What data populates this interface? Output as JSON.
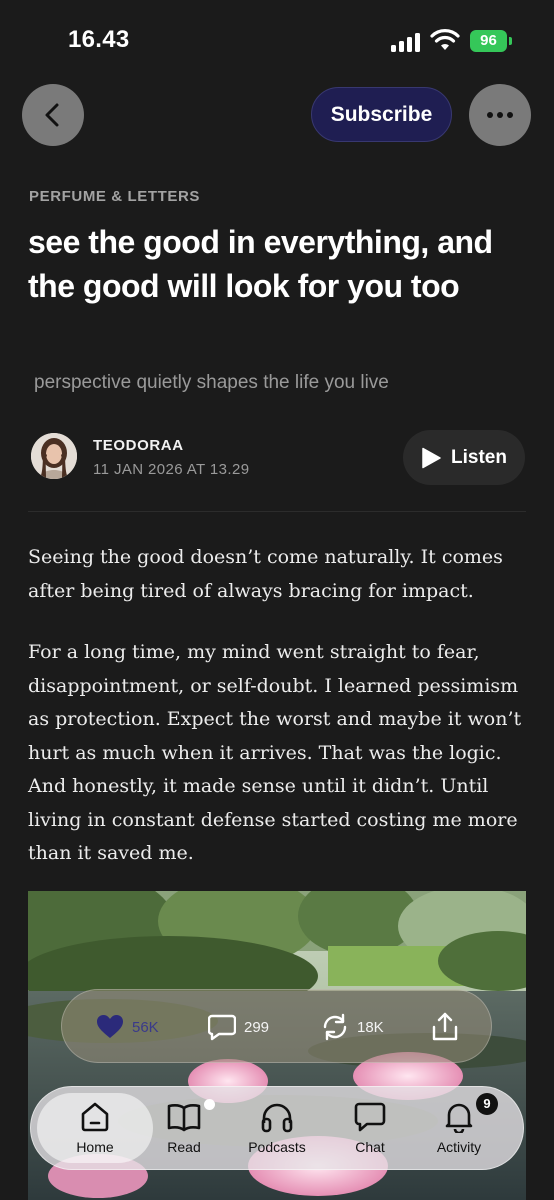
{
  "status_bar": {
    "time": "16.43",
    "battery": "96"
  },
  "nav": {
    "subscribe_label": "Subscribe",
    "back_icon": "chevron-left-icon",
    "more_icon": "ellipsis-icon"
  },
  "article": {
    "publication": "PERFUME & LETTERS",
    "title": "see the good in everything, and the good will look for you too",
    "subtitle": "perspective quietly shapes the life you live",
    "author": "TEODORAA",
    "date": "11 JAN 2026 AT 13.29",
    "listen_label": "Listen",
    "paragraphs": [
      " Seeing the good doesn’t come naturally. It comes after being tired of always bracing for impact.",
      " For a long time, my mind went straight to fear, disappointment, or self-doubt. I learned pessimism as protection. Expect the worst and maybe it won’t hurt as much when it arrives. That was the logic. And honestly, it made sense until it didn’t. Until living in constant defense started costing me more than it saved me."
    ]
  },
  "actions": {
    "likes": "56K",
    "comments": "299",
    "restacks": "18K"
  },
  "tabs": [
    {
      "label": "Home",
      "icon": "home-icon"
    },
    {
      "label": "Read",
      "icon": "book-icon"
    },
    {
      "label": "Podcasts",
      "icon": "headphones-icon"
    },
    {
      "label": "Chat",
      "icon": "chat-bubble-icon"
    },
    {
      "label": "Activity",
      "icon": "bell-icon"
    }
  ],
  "activity_badge": "9",
  "colors": {
    "background": "#1b1b1b",
    "subscribe_bg": "#1f1e52",
    "heart": "#2b2a7a",
    "battery": "#35c759"
  }
}
